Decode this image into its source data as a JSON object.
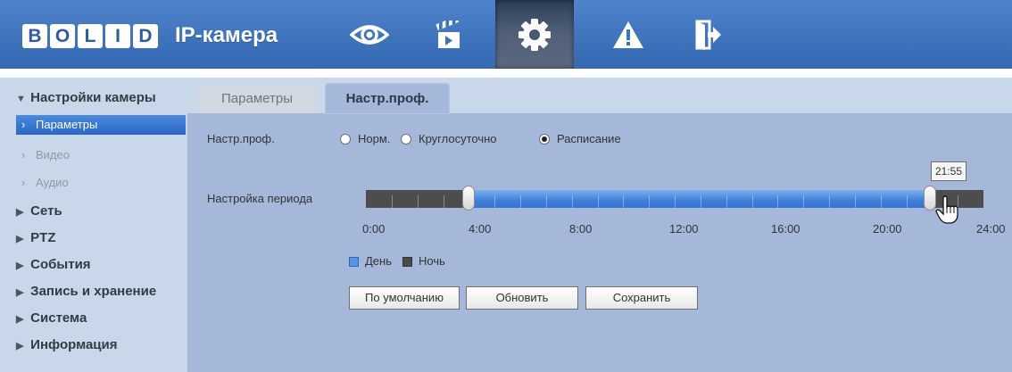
{
  "header": {
    "logo_letters": [
      "B",
      "O",
      "L",
      "I",
      "D"
    ],
    "brand_suffix": "IP-камера",
    "nav": [
      {
        "name": "live-view",
        "icon": "eye-icon"
      },
      {
        "name": "playback",
        "icon": "clapperboard-icon"
      },
      {
        "name": "settings",
        "icon": "gear-icon",
        "active": true
      },
      {
        "name": "alarm",
        "icon": "warning-icon"
      },
      {
        "name": "logout",
        "icon": "exit-icon"
      }
    ]
  },
  "sidebar": {
    "groups": [
      {
        "label": "Настройки камеры",
        "expanded": true,
        "items": [
          {
            "label": "Параметры",
            "active": true
          },
          {
            "label": "Видео"
          },
          {
            "label": "Аудио"
          }
        ]
      },
      {
        "label": "Сеть"
      },
      {
        "label": "PTZ"
      },
      {
        "label": "События"
      },
      {
        "label": "Запись и хранение"
      },
      {
        "label": "Система"
      },
      {
        "label": "Информация"
      }
    ]
  },
  "tabs": [
    "Параметры",
    "Настр.проф."
  ],
  "form": {
    "profile_label": "Настр.проф.",
    "options": [
      "Норм.",
      "Круглосуточно",
      "Расписание"
    ],
    "selected_option": "Расписание",
    "period_label": "Настройка периода",
    "tooltip": "21:55",
    "schedule": {
      "day_start": "4:00",
      "day_end": "21:55",
      "day_start_hours": 4.0,
      "day_end_hours": 21.9167,
      "total_hours": 24
    },
    "axis": [
      "0:00",
      "4:00",
      "8:00",
      "12:00",
      "16:00",
      "20:00",
      "24:00"
    ],
    "legend": [
      {
        "label": "День",
        "color": "#3f7fd9"
      },
      {
        "label": "Ночь",
        "color": "#4b4b4b"
      }
    ],
    "buttons": [
      "По умолчанию",
      "Обновить",
      "Сохранить"
    ]
  },
  "colors": {
    "header": "#3f74bd",
    "content_bg": "#a5b8d9",
    "sidebar_bg": "#c9d7ea",
    "day": "#3f7fd9",
    "night": "#4b4b4b"
  }
}
